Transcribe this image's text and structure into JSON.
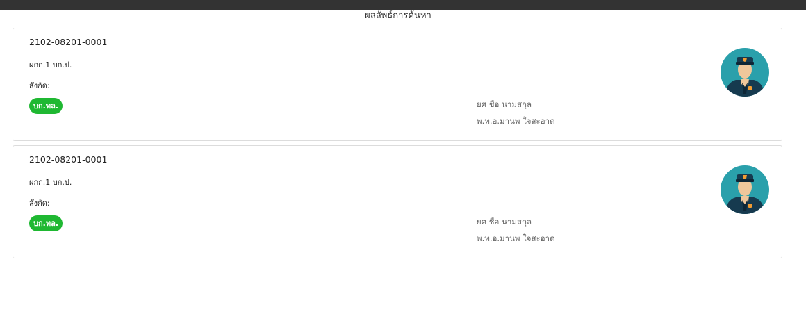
{
  "page": {
    "title": "ผลลัพธ์การค้นหา"
  },
  "results": [
    {
      "case_id": "2102-08201-0001",
      "unit": "ผกก.1 บก.ป.",
      "affiliation_label": "สังกัด:",
      "badge": "บก.ทล.",
      "name_label": "ยศ ชื่อ นามสกุล",
      "name_value": "พ.ท.อ.มานพ ใจสะอาด",
      "avatar_icon": "police-officer-icon"
    },
    {
      "case_id": "2102-08201-0001",
      "unit": "ผกก.1 บก.ป.",
      "affiliation_label": "สังกัด:",
      "badge": "บก.ทล.",
      "name_label": "ยศ ชื่อ นามสกุล",
      "name_value": "พ.ท.อ.มานพ ใจสะอาด",
      "avatar_icon": "police-officer-icon"
    }
  ],
  "colors": {
    "topbar": "#333333",
    "badge": "#1fb832",
    "avatar_bg": "#2aa0ab",
    "uniform": "#163a4f",
    "skin": "#efc79b",
    "emblem": "#f39c32"
  }
}
